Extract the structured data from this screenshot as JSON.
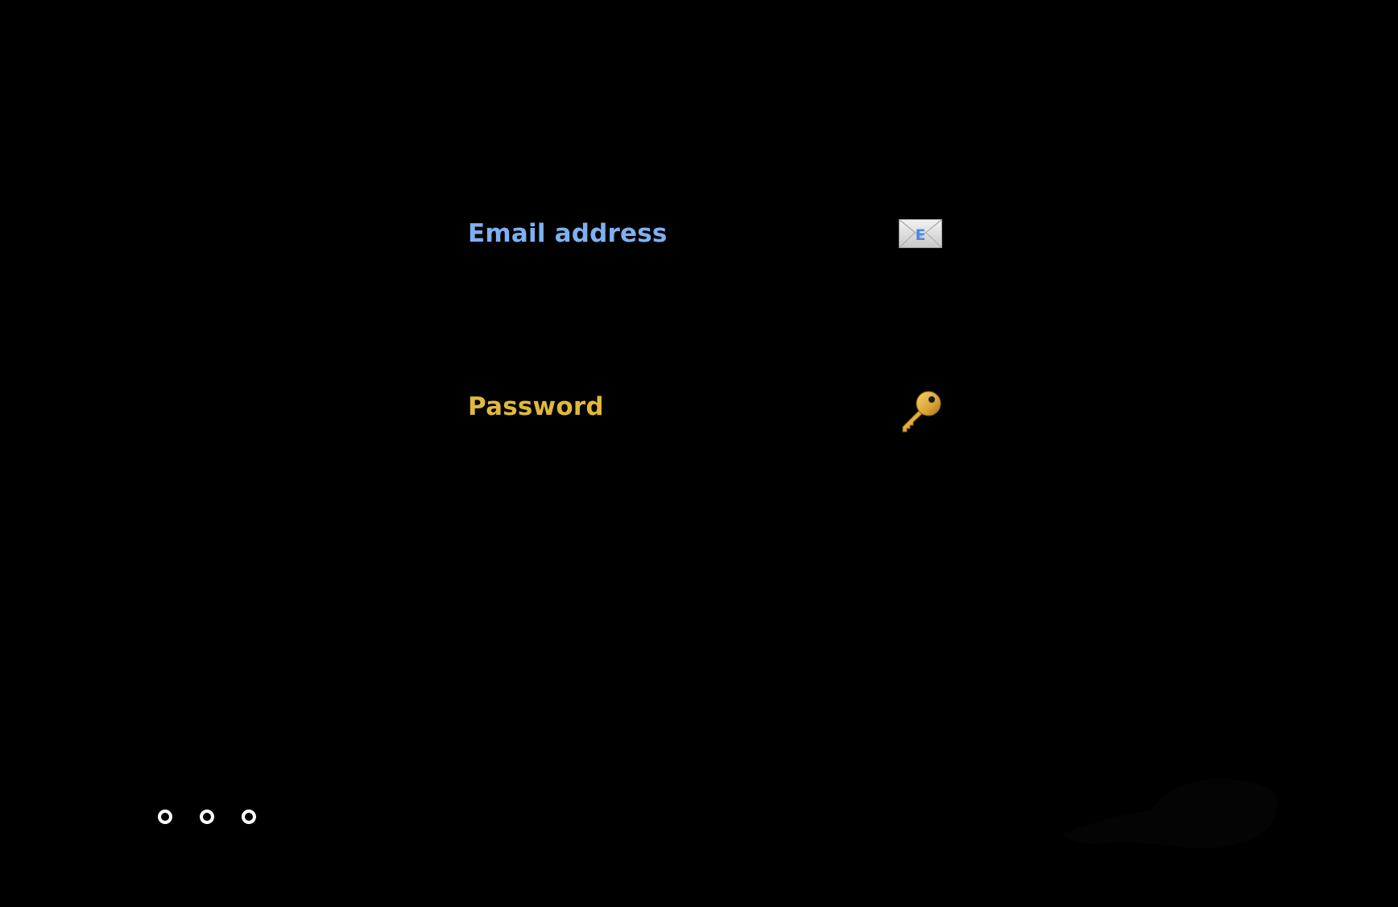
{
  "form": {
    "email": {
      "label": "Email address",
      "value": "",
      "icon": "envelope-icon",
      "icon_letter": "E",
      "color": "#7fb0f0"
    },
    "password": {
      "label": "Password",
      "value": "",
      "icon": "key-icon",
      "color": "#e0b83c"
    }
  },
  "indicator": {
    "icon": "loading-dots",
    "count": 3
  },
  "colors": {
    "background": "#000000",
    "email_accent": "#7fb0f0",
    "password_accent": "#e0b83c",
    "dots": "#ffffff"
  }
}
